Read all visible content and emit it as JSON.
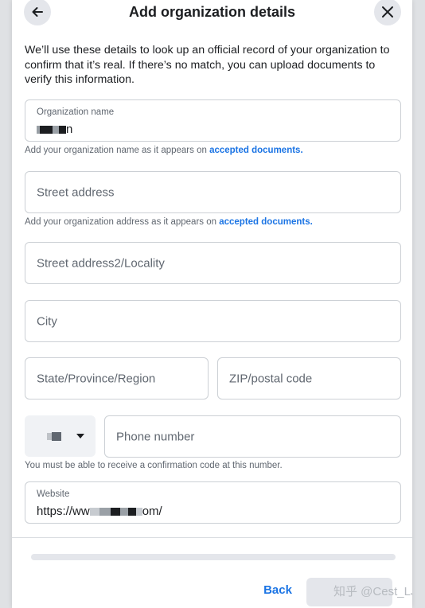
{
  "header": {
    "title": "Add organization details"
  },
  "intro": "We’ll use these details to look up an official record of your organization to confirm that it’s real. If there’s no match, you can upload documents to verify this information.",
  "org_name": {
    "label": "Organization name",
    "value_visible_suffix": "n"
  },
  "org_helper": {
    "text": "Add your organization name as it appears on ",
    "link": "accepted documents."
  },
  "street": {
    "placeholder": "Street address"
  },
  "address_helper": {
    "text": "Add your organization address as it appears on ",
    "link": "accepted documents."
  },
  "street2": {
    "placeholder": "Street address2/Locality"
  },
  "city": {
    "placeholder": "City"
  },
  "state": {
    "placeholder": "State/Province/Region"
  },
  "zip": {
    "placeholder": "ZIP/postal code"
  },
  "phone": {
    "placeholder": "Phone number",
    "helper": "You must be able to receive a confirmation code at this number."
  },
  "website": {
    "label": "Website",
    "value_prefix": "https://ww",
    "value_suffix": "om/"
  },
  "footer": {
    "back_label": "Back",
    "watermark": "知乎 @Cest_LJs"
  },
  "colors": {
    "link": "#1b74e4",
    "text": "#1c1e21",
    "muted": "#606770",
    "border": "#ccd0d5"
  }
}
